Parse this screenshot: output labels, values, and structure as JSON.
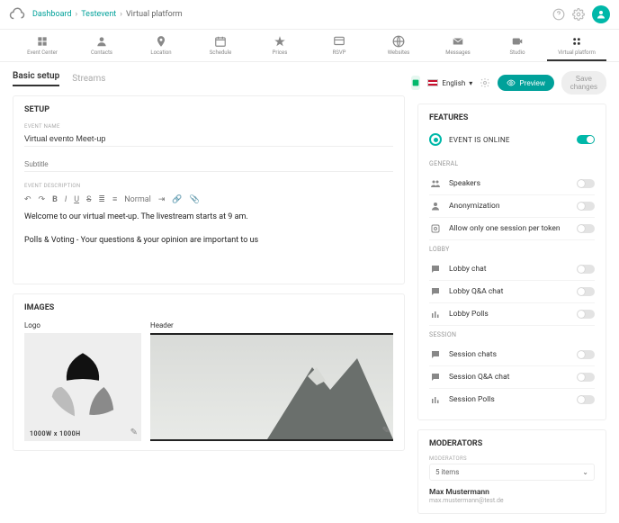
{
  "breadcrumb": {
    "a": "Dashboard",
    "b": "Testevent",
    "c": "Virtual platform"
  },
  "nav": {
    "items": [
      {
        "label": "Event Center"
      },
      {
        "label": "Contacts"
      },
      {
        "label": "Location"
      },
      {
        "label": "Schedule"
      },
      {
        "label": "Prices"
      },
      {
        "label": "RSVP"
      },
      {
        "label": "Websites"
      },
      {
        "label": "Messages"
      },
      {
        "label": "Studio"
      },
      {
        "label": "Virtual platform"
      }
    ]
  },
  "tabs": {
    "basic": "Basic setup",
    "streams": "Streams"
  },
  "toolbar": {
    "lang": "English",
    "preview": "Preview",
    "save": "Save changes"
  },
  "setup": {
    "title": "SETUP",
    "name_label": "EVENT NAME",
    "name_value": "Virtual evento Meet-up",
    "subtitle_placeholder": "Subtitle",
    "desc_label": "EVENT DESCRIPTION",
    "desc_p1": "Welcome to our virtual meet-up. The livestream starts at 9 am.",
    "desc_p2": "Polls & Voting - Your questions & your opinion are important to us",
    "rte_normal": "Normal"
  },
  "images": {
    "title": "IMAGES",
    "logo_label": "Logo",
    "header_label": "Header",
    "logo_dims": "1000W x 1000H"
  },
  "features": {
    "title": "FEATURES",
    "online": "EVENT IS ONLINE",
    "general": "GENERAL",
    "speakers": "Speakers",
    "anon": "Anonymization",
    "onesession": "Allow only one session per token",
    "lobby": "LOBBY",
    "lobby_chat": "Lobby chat",
    "lobby_qa": "Lobby Q&A chat",
    "lobby_polls": "Lobby Polls",
    "session": "SESSION",
    "session_chats": "Session chats",
    "session_qa": "Session Q&A chat",
    "session_polls": "Session Polls"
  },
  "moderators": {
    "title": "MODERATORS",
    "label": "MODERATORS",
    "count": "5 items",
    "name": "Max Mustermann",
    "email": "max.mustermann@test.de"
  }
}
